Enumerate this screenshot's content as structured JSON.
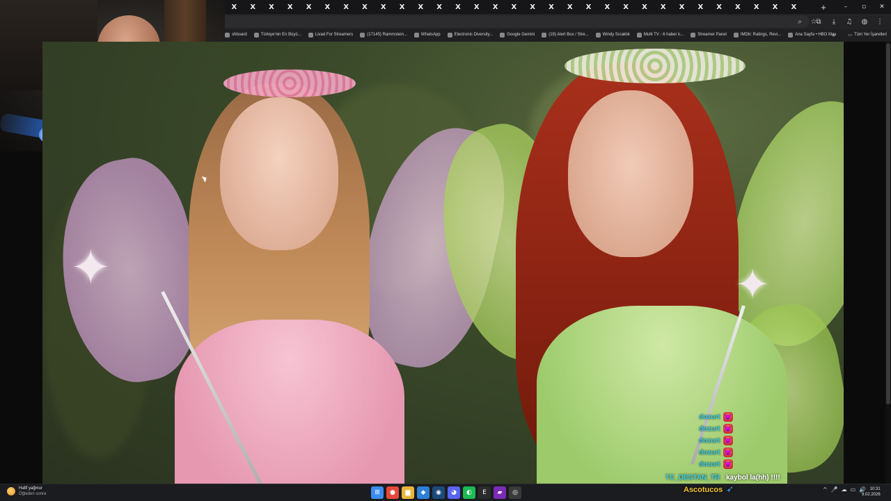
{
  "browser": {
    "tab_glyph": "X",
    "tab_count": 31,
    "new_tab": "+",
    "window_controls": [
      "–",
      "▫",
      "✕"
    ],
    "bookmarks": [
      {
        "label": "shboard",
        "icon": "dashboard-icon"
      },
      {
        "label": "Türkiye'nin En Büyü...",
        "icon": "bookmark-icon"
      },
      {
        "label": "Livad For Streamers",
        "icon": "livad-icon"
      },
      {
        "label": "(17145) Rammstein...",
        "icon": "youtube-icon"
      },
      {
        "label": "WhatsApp",
        "icon": "whatsapp-icon"
      },
      {
        "label": "Electronic Diversity...",
        "icon": "page-icon"
      },
      {
        "label": "Google Gemini",
        "icon": "gemini-icon"
      },
      {
        "label": "(19) Alert Box / Stre...",
        "icon": "alertbox-icon"
      },
      {
        "label": "Windy Sıcaklık",
        "icon": "windy-icon"
      },
      {
        "label": "Multi TV - 6 haber k...",
        "icon": "tv-icon"
      },
      {
        "label": "Streamer Panel",
        "icon": "panel-icon"
      },
      {
        "label": "IMDb: Ratings, Revi...",
        "icon": "imdb-icon"
      },
      {
        "label": "Ana Sayfa • HBO Max",
        "icon": "hbo-icon"
      }
    ],
    "bookmarks_more": "»",
    "all_bookmarks": "Tüm Yer İşaretleri"
  },
  "chat": {
    "repeated_user": "dozurt",
    "repeated_count": 5,
    "last_user": "TC_DESTAN_TR",
    "last_message": "kaybol la(hh) !!!!"
  },
  "overlay": {
    "brand": "Ascotucos",
    "brand_icon": "feather-icon"
  },
  "taskbar": {
    "weather_title": "Hafif yağmur",
    "weather_sub": "Öğleden sonra",
    "apps": [
      {
        "name": "start-icon",
        "glyph": "⊞",
        "color": "#3b8cf0"
      },
      {
        "name": "chrome-icon",
        "glyph": "●",
        "color": "#e6483b"
      },
      {
        "name": "file-explorer-icon",
        "glyph": "▆",
        "color": "#e8b63a"
      },
      {
        "name": "vscode-icon",
        "glyph": "◆",
        "color": "#2d7fd6"
      },
      {
        "name": "steam-icon",
        "glyph": "◉",
        "color": "#1c4b7a"
      },
      {
        "name": "discord-icon",
        "glyph": "◕",
        "color": "#5865f2"
      },
      {
        "name": "spotify-icon",
        "glyph": "◐",
        "color": "#1db954"
      },
      {
        "name": "epic-games-icon",
        "glyph": "E",
        "color": "#2b2b2b"
      },
      {
        "name": "obs-icon",
        "glyph": "▰",
        "color": "#7b2cb4"
      },
      {
        "name": "recording-icon",
        "glyph": "◎",
        "color": "#3a3a3a"
      }
    ],
    "tray": [
      "^",
      "🎤",
      "☁",
      "▭",
      "🔊"
    ],
    "time": "10:31",
    "date": "9.02.2026"
  }
}
